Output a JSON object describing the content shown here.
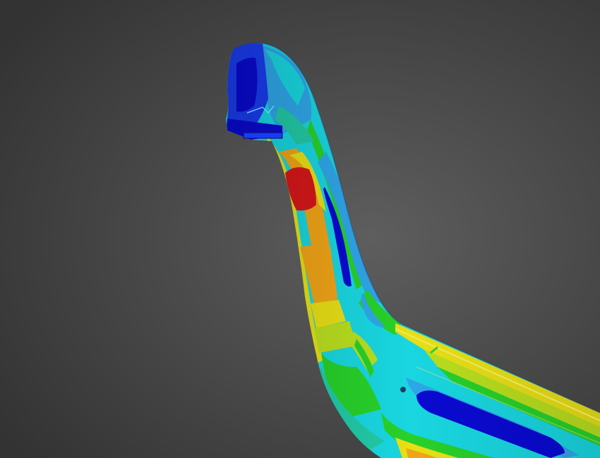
{
  "scene": {
    "kind": "fea-stress-contour-render",
    "background": {
      "center": "#5e5e5e",
      "edge": "#333333"
    },
    "palette": {
      "deep_blue": "#0a0ad2",
      "blue": "#1a3cf0",
      "light_blue": "#2fa6e8",
      "cyan": "#19d6e0",
      "teal": "#22c9a6",
      "green": "#28d02a",
      "yellow_green": "#b9de1e",
      "yellow": "#e8df16",
      "orange": "#f0a418",
      "red": "#d6171a"
    }
  }
}
